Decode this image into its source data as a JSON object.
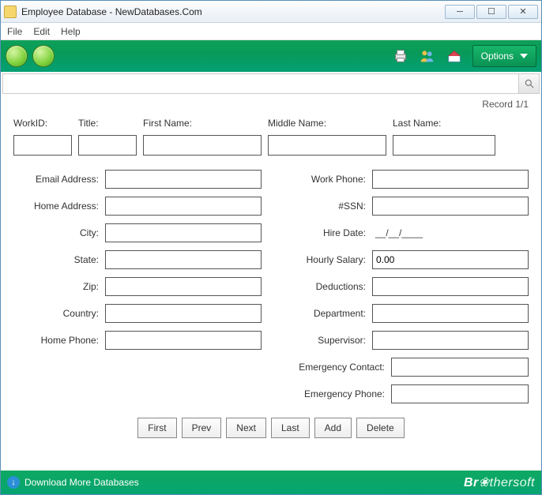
{
  "window": {
    "title": "Employee Database - NewDatabases.Com"
  },
  "menu": {
    "file": "File",
    "edit": "Edit",
    "help": "Help"
  },
  "toolbar": {
    "options": "Options"
  },
  "record_indicator": "Record 1/1",
  "top_labels": {
    "workid": "WorkID:",
    "title": "Title:",
    "firstname": "First Name:",
    "middlename": "Middle Name:",
    "lastname": "Last Name:"
  },
  "left_labels": {
    "email": "Email Address:",
    "home_addr": "Home Address:",
    "city": "City:",
    "state": "State:",
    "zip": "Zip:",
    "country": "Country:",
    "home_phone": "Home Phone:"
  },
  "right_labels": {
    "work_phone": "Work Phone:",
    "ssn": "#SSN:",
    "hire_date": "Hire Date:",
    "hourly": "Hourly Salary:",
    "deductions": "Deductions:",
    "department": "Department:",
    "supervisor": "Supervisor:",
    "emerg_contact": "Emergency Contact:",
    "emerg_phone": "Emergency Phone:"
  },
  "right_values": {
    "hire_date": "__/__/____",
    "hourly": "0.00"
  },
  "nav": {
    "first": "First",
    "prev": "Prev",
    "next": "Next",
    "last": "Last",
    "add": "Add",
    "delete": "Delete"
  },
  "footer": {
    "download": "Download More Databases",
    "brand_prefix": "Br",
    "brand_suffix": "thersoft"
  }
}
